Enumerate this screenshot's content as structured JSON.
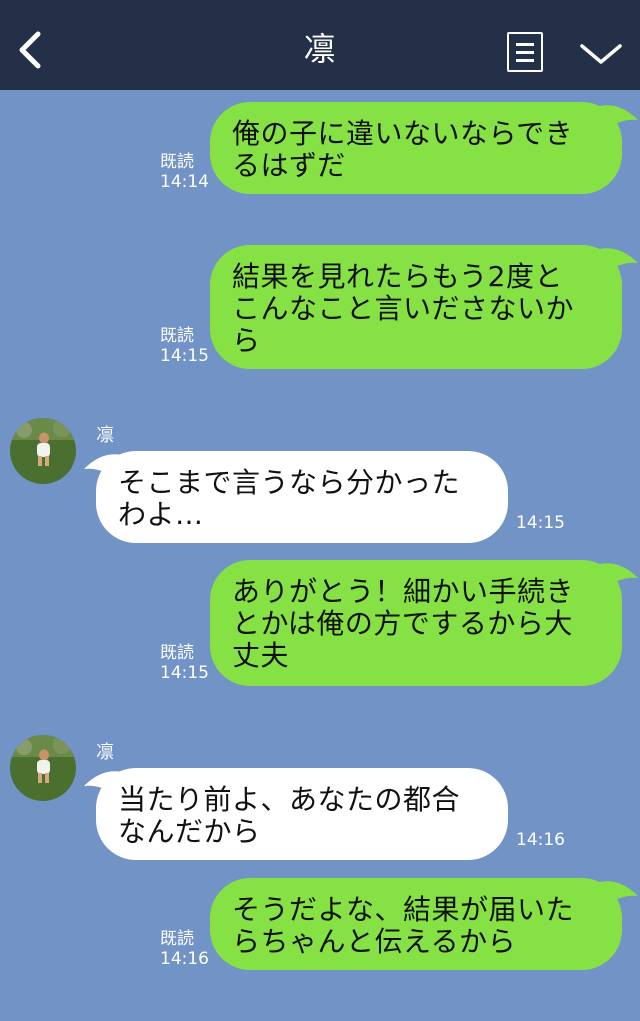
{
  "header": {
    "title": "凛",
    "back_icon": "chevron-left-icon",
    "menu_icon": "menu-list-icon",
    "dropdown_icon": "chevron-down-icon"
  },
  "colors": {
    "header_bg": "#243048",
    "chat_bg": "#7293c5",
    "my_bubble": "#86e244",
    "their_bubble": "#ffffff"
  },
  "messages": [
    {
      "from": "me",
      "text": "俺の子に違いないならでき\nるはずだ",
      "read": "既読",
      "time": "14:14"
    },
    {
      "from": "me",
      "text": "結果を見れたらもう2度と\nこんなこと言いださないか\nら",
      "read": "既読",
      "time": "14:15"
    },
    {
      "from": "them",
      "sender": "凛",
      "text": "そこまで言うなら分かった\nわよ…",
      "time": "14:15"
    },
    {
      "from": "me",
      "text": "ありがとう！細かい手続き\nとかは俺の方でするから大\n丈夫",
      "read": "既読",
      "time": "14:15"
    },
    {
      "from": "them",
      "sender": "凛",
      "text": "当たり前よ、あなたの都合\nなんだから",
      "time": "14:16"
    },
    {
      "from": "me",
      "text": "そうだよな、結果が届いた\nらちゃんと伝えるから",
      "read": "既読",
      "time": "14:16"
    }
  ]
}
